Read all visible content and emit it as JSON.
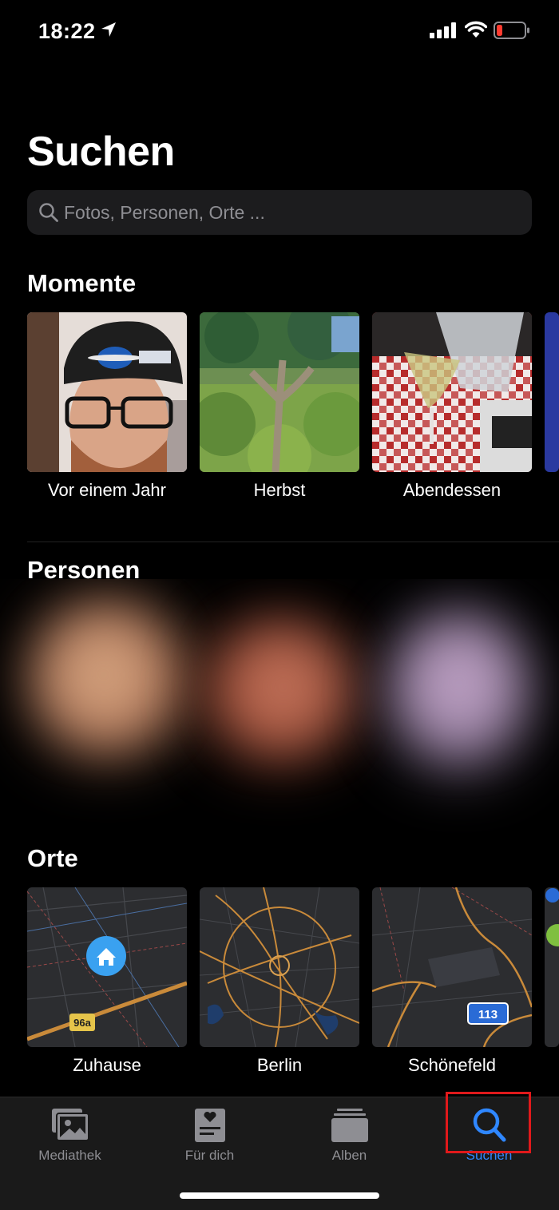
{
  "status_bar": {
    "time": "18:22"
  },
  "page": {
    "title": "Suchen"
  },
  "search": {
    "placeholder": "Fotos, Personen, Orte ..."
  },
  "moments": {
    "title": "Momente",
    "items": [
      {
        "label": "Vor einem Jahr"
      },
      {
        "label": "Herbst"
      },
      {
        "label": "Abendessen"
      }
    ]
  },
  "people": {
    "title": "Personen"
  },
  "places": {
    "title": "Orte",
    "items": [
      {
        "label": "Zuhause",
        "badge": "96a"
      },
      {
        "label": "Berlin"
      },
      {
        "label": "Schönefeld",
        "badge": "113"
      }
    ]
  },
  "tabbar": {
    "items": [
      {
        "label": "Mediathek"
      },
      {
        "label": "Für dich"
      },
      {
        "label": "Alben"
      },
      {
        "label": "Suchen"
      }
    ]
  },
  "colors": {
    "accent": "#2f87ff",
    "background": "#000000",
    "search_field": "#1c1c1e",
    "highlight": "#e0191b",
    "map_roads": "#c98a3a"
  }
}
